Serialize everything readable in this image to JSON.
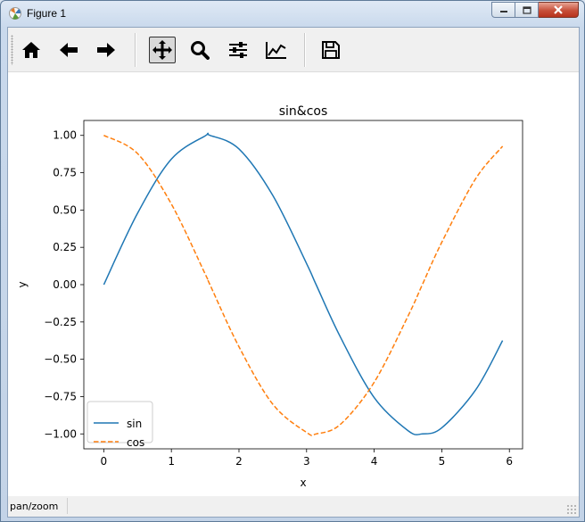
{
  "window": {
    "title": "Figure 1"
  },
  "toolbar": {
    "buttons": [
      {
        "name": "home-button",
        "icon": "home-icon"
      },
      {
        "name": "back-button",
        "icon": "arrow-left-icon"
      },
      {
        "name": "forward-button",
        "icon": "arrow-right-icon"
      },
      {
        "name": "pan-button",
        "icon": "move-icon",
        "active": true
      },
      {
        "name": "zoom-button",
        "icon": "magnifier-icon"
      },
      {
        "name": "subplots-button",
        "icon": "sliders-icon"
      },
      {
        "name": "edit-axis-button",
        "icon": "chart-line-icon"
      },
      {
        "name": "save-button",
        "icon": "floppy-disk-icon"
      }
    ]
  },
  "status": {
    "mode": "pan/zoom"
  },
  "colors": {
    "sin": "#1f77b4",
    "cos": "#ff7f0e"
  },
  "chart_data": {
    "type": "line",
    "title": "sin&cos",
    "xlabel": "x",
    "ylabel": "y",
    "xlim": [
      -0.295,
      6.195
    ],
    "ylim": [
      -1.1,
      1.1
    ],
    "xticks": [
      0,
      1,
      2,
      3,
      4,
      5,
      6
    ],
    "yticks": [
      1.0,
      0.75,
      0.5,
      0.25,
      0.0,
      -0.25,
      -0.5,
      -0.75,
      -1.0
    ],
    "ytick_labels": [
      "1.00",
      "0.75",
      "0.50",
      "0.25",
      "0.00",
      "−0.25",
      "−0.50",
      "−0.75",
      "−1.00"
    ],
    "xtick_labels": [
      "0",
      "1",
      "2",
      "3",
      "4",
      "5",
      "6"
    ],
    "grid": false,
    "legend_position": "lower-left",
    "x": [
      0.0,
      0.5,
      1.0,
      1.5,
      1.5708,
      2.0,
      2.5,
      3.0,
      3.1416,
      3.5,
      4.0,
      4.5,
      4.7124,
      5.0,
      5.5,
      5.9
    ],
    "series": [
      {
        "name": "sin",
        "style": "solid",
        "values": [
          0.0,
          0.479,
          0.841,
          0.997,
          1.0,
          0.909,
          0.598,
          0.141,
          0.0,
          -0.351,
          -0.757,
          -0.978,
          -1.0,
          -0.959,
          -0.706,
          -0.374
        ]
      },
      {
        "name": "cos",
        "style": "dashed",
        "values": [
          1.0,
          0.878,
          0.54,
          0.071,
          0.0,
          -0.416,
          -0.801,
          -0.99,
          -1.0,
          -0.936,
          -0.654,
          -0.211,
          0.0,
          0.284,
          0.709,
          0.927
        ]
      }
    ]
  }
}
